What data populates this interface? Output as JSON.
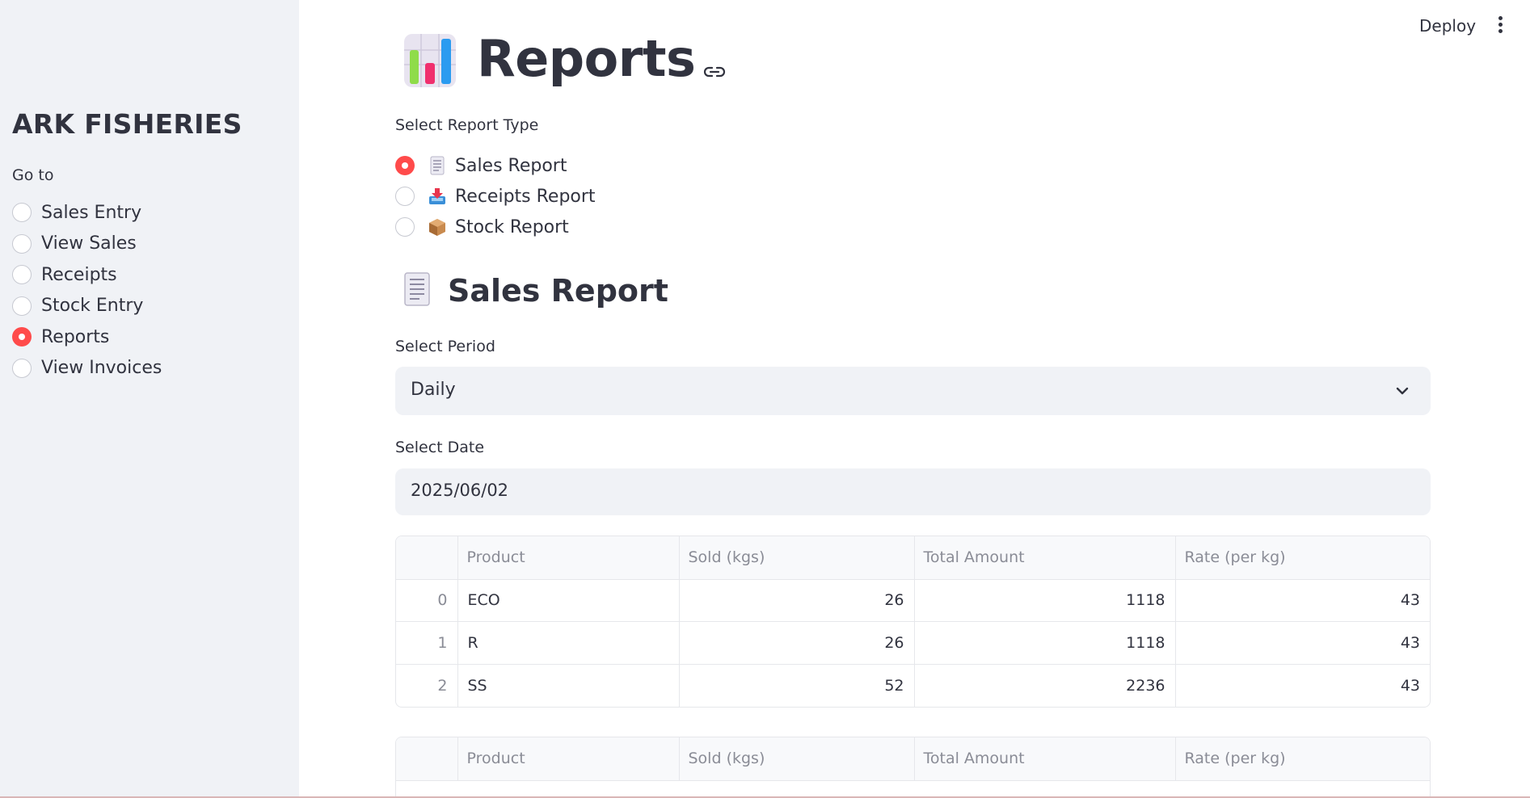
{
  "sidebar": {
    "brand": "ARK FISHERIES",
    "goto_label": "Go to",
    "items": [
      {
        "label": "Sales Entry",
        "selected": false
      },
      {
        "label": "View Sales",
        "selected": false
      },
      {
        "label": "Receipts",
        "selected": false
      },
      {
        "label": "Stock Entry",
        "selected": false
      },
      {
        "label": "Reports",
        "selected": true
      },
      {
        "label": "View Invoices",
        "selected": false
      }
    ]
  },
  "header": {
    "deploy_label": "Deploy",
    "menu_icon": "kebab-menu-icon"
  },
  "page": {
    "title": "Reports",
    "title_icon": "bar-chart-icon",
    "link_icon": "link-icon"
  },
  "report_type": {
    "label": "Select Report Type",
    "options": [
      {
        "label": "Sales Report",
        "icon": "receipt-icon",
        "selected": true
      },
      {
        "label": "Receipts Report",
        "icon": "inbox-tray-icon",
        "selected": false
      },
      {
        "label": "Stock Report",
        "icon": "package-icon",
        "selected": false
      }
    ]
  },
  "section": {
    "title": "Sales Report",
    "icon": "receipt-icon"
  },
  "period": {
    "label": "Select Period",
    "value": "Daily"
  },
  "date": {
    "label": "Select Date",
    "value": "2025/06/02"
  },
  "table1": {
    "columns": [
      "",
      "Product",
      "Sold (kgs)",
      "Total Amount",
      "Rate (per kg)"
    ],
    "rows": [
      {
        "index": "0",
        "product": "ECO",
        "sold": "26",
        "total": "1118",
        "rate": "43"
      },
      {
        "index": "1",
        "product": "R",
        "sold": "26",
        "total": "1118",
        "rate": "43"
      },
      {
        "index": "2",
        "product": "SS",
        "sold": "52",
        "total": "2236",
        "rate": "43"
      }
    ]
  },
  "table2": {
    "columns": [
      "",
      "Product",
      "Sold (kgs)",
      "Total Amount",
      "Rate (per kg)"
    ]
  },
  "colors": {
    "accent": "#ff4b4b",
    "sidebar_bg": "#f0f2f6",
    "text": "#31333f"
  }
}
